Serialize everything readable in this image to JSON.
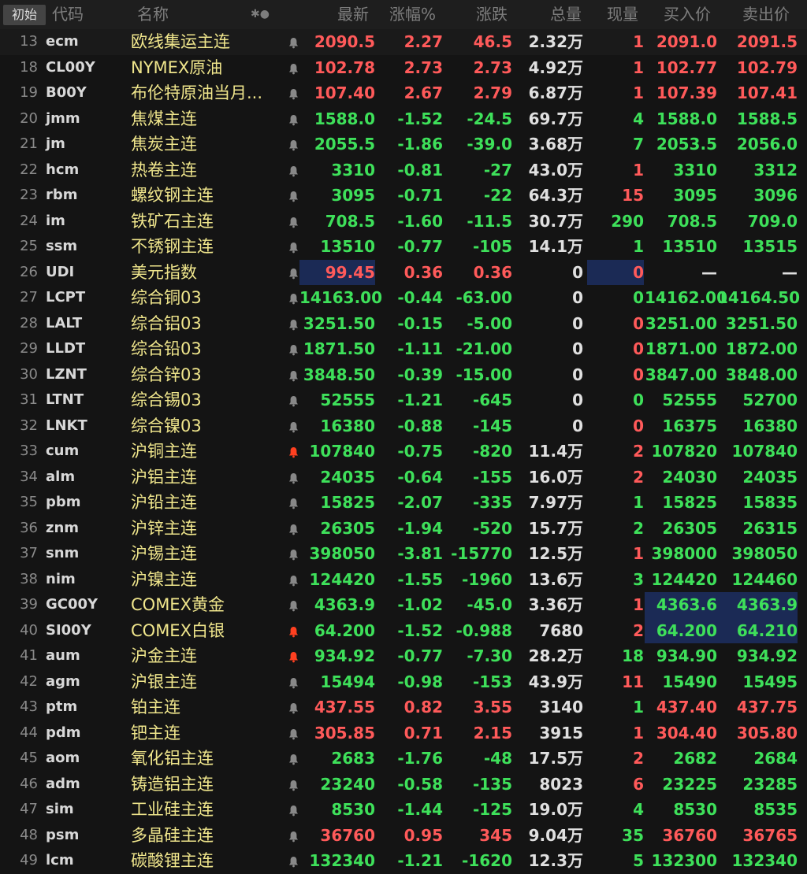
{
  "header": {
    "init_label": "初始",
    "col_code": "代码",
    "col_name": "名称",
    "col_icons": "✱●",
    "col_last": "最新",
    "col_pct": "涨幅%",
    "col_chg": "涨跌",
    "col_vol": "总量",
    "col_cur": "现量",
    "col_bid": "买入价",
    "col_ask": "卖出价"
  },
  "colors": {
    "up": "#ff5a5a",
    "down": "#3ee05a",
    "name": "#f0e68c",
    "bell_active": "#ff4020",
    "bell_idle": "#888888"
  },
  "rows": [
    {
      "num": "13",
      "code": "ecm",
      "name": "欧线集运主连",
      "bell": "idle",
      "last": "2090.5",
      "pct": "2.27",
      "chg": "46.5",
      "vol": "2.32万",
      "cur": "1",
      "bid": "2091.0",
      "ask": "2091.5",
      "dir": "up",
      "cur_dir": "up"
    },
    {
      "num": "18",
      "code": "CL00Y",
      "name": "NYMEX原油",
      "bell": "idle",
      "last": "102.78",
      "pct": "2.73",
      "chg": "2.73",
      "vol": "4.92万",
      "cur": "1",
      "bid": "102.77",
      "ask": "102.79",
      "dir": "up",
      "cur_dir": "up"
    },
    {
      "num": "19",
      "code": "B00Y",
      "name": "布伦特原油当月...",
      "bell": "idle",
      "last": "107.40",
      "pct": "2.67",
      "chg": "2.79",
      "vol": "6.87万",
      "cur": "1",
      "bid": "107.39",
      "ask": "107.41",
      "dir": "up",
      "cur_dir": "up"
    },
    {
      "num": "20",
      "code": "jmm",
      "name": "焦煤主连",
      "bell": "idle",
      "last": "1588.0",
      "pct": "-1.52",
      "chg": "-24.5",
      "vol": "69.7万",
      "cur": "4",
      "bid": "1588.0",
      "ask": "1588.5",
      "dir": "down",
      "cur_dir": "down"
    },
    {
      "num": "21",
      "code": "jm",
      "name": "焦炭主连",
      "bell": "idle",
      "last": "2055.5",
      "pct": "-1.86",
      "chg": "-39.0",
      "vol": "3.68万",
      "cur": "7",
      "bid": "2053.5",
      "ask": "2056.0",
      "dir": "down",
      "cur_dir": "down"
    },
    {
      "num": "22",
      "code": "hcm",
      "name": "热卷主连",
      "bell": "idle",
      "last": "3310",
      "pct": "-0.81",
      "chg": "-27",
      "vol": "43.0万",
      "cur": "1",
      "bid": "3310",
      "ask": "3312",
      "dir": "down",
      "cur_dir": "up"
    },
    {
      "num": "23",
      "code": "rbm",
      "name": "螺纹钢主连",
      "bell": "idle",
      "last": "3095",
      "pct": "-0.71",
      "chg": "-22",
      "vol": "64.3万",
      "cur": "15",
      "bid": "3095",
      "ask": "3096",
      "dir": "down",
      "cur_dir": "up"
    },
    {
      "num": "24",
      "code": "im",
      "name": "铁矿石主连",
      "bell": "idle",
      "last": "708.5",
      "pct": "-1.60",
      "chg": "-11.5",
      "vol": "30.7万",
      "cur": "290",
      "bid": "708.5",
      "ask": "709.0",
      "dir": "down",
      "cur_dir": "down"
    },
    {
      "num": "25",
      "code": "ssm",
      "name": "不锈钢主连",
      "bell": "idle",
      "last": "13510",
      "pct": "-0.77",
      "chg": "-105",
      "vol": "14.1万",
      "cur": "1",
      "bid": "13510",
      "ask": "13515",
      "dir": "down",
      "cur_dir": "down"
    },
    {
      "num": "26",
      "code": "UDI",
      "name": "美元指数",
      "bell": "idle",
      "last": "99.45",
      "pct": "0.36",
      "chg": "0.36",
      "vol": "0",
      "cur": "0",
      "bid": "—",
      "ask": "—",
      "dir": "up",
      "cur_dir": "up",
      "hl": true
    },
    {
      "num": "27",
      "code": "LCPT",
      "name": "综合铜03",
      "bell": "idle",
      "last": "14163.00",
      "pct": "-0.44",
      "chg": "-63.00",
      "vol": "0",
      "cur": "0",
      "bid": "14162.00",
      "ask": "14164.50",
      "dir": "down",
      "cur_dir": "down"
    },
    {
      "num": "28",
      "code": "LALT",
      "name": "综合铝03",
      "bell": "idle",
      "last": "3251.50",
      "pct": "-0.15",
      "chg": "-5.00",
      "vol": "0",
      "cur": "0",
      "bid": "3251.00",
      "ask": "3251.50",
      "dir": "down",
      "cur_dir": "up"
    },
    {
      "num": "29",
      "code": "LLDT",
      "name": "综合铅03",
      "bell": "idle",
      "last": "1871.50",
      "pct": "-1.11",
      "chg": "-21.00",
      "vol": "0",
      "cur": "0",
      "bid": "1871.00",
      "ask": "1872.00",
      "dir": "down",
      "cur_dir": "up"
    },
    {
      "num": "30",
      "code": "LZNT",
      "name": "综合锌03",
      "bell": "idle",
      "last": "3848.50",
      "pct": "-0.39",
      "chg": "-15.00",
      "vol": "0",
      "cur": "0",
      "bid": "3847.00",
      "ask": "3848.00",
      "dir": "down",
      "cur_dir": "up"
    },
    {
      "num": "31",
      "code": "LTNT",
      "name": "综合锡03",
      "bell": "idle",
      "last": "52555",
      "pct": "-1.21",
      "chg": "-645",
      "vol": "0",
      "cur": "0",
      "bid": "52555",
      "ask": "52700",
      "dir": "down",
      "cur_dir": "down"
    },
    {
      "num": "32",
      "code": "LNKT",
      "name": "综合镍03",
      "bell": "idle",
      "last": "16380",
      "pct": "-0.88",
      "chg": "-145",
      "vol": "0",
      "cur": "0",
      "bid": "16375",
      "ask": "16380",
      "dir": "down",
      "cur_dir": "up"
    },
    {
      "num": "33",
      "code": "cum",
      "name": "沪铜主连",
      "bell": "active",
      "last": "107840",
      "pct": "-0.75",
      "chg": "-820",
      "vol": "11.4万",
      "cur": "2",
      "bid": "107820",
      "ask": "107840",
      "dir": "down",
      "cur_dir": "up"
    },
    {
      "num": "34",
      "code": "alm",
      "name": "沪铝主连",
      "bell": "idle",
      "last": "24035",
      "pct": "-0.64",
      "chg": "-155",
      "vol": "16.0万",
      "cur": "2",
      "bid": "24030",
      "ask": "24035",
      "dir": "down",
      "cur_dir": "up"
    },
    {
      "num": "35",
      "code": "pbm",
      "name": "沪铅主连",
      "bell": "idle",
      "last": "15825",
      "pct": "-2.07",
      "chg": "-335",
      "vol": "7.97万",
      "cur": "1",
      "bid": "15825",
      "ask": "15835",
      "dir": "down",
      "cur_dir": "down"
    },
    {
      "num": "36",
      "code": "znm",
      "name": "沪锌主连",
      "bell": "idle",
      "last": "26305",
      "pct": "-1.94",
      "chg": "-520",
      "vol": "15.7万",
      "cur": "2",
      "bid": "26305",
      "ask": "26315",
      "dir": "down",
      "cur_dir": "down"
    },
    {
      "num": "37",
      "code": "snm",
      "name": "沪锡主连",
      "bell": "idle",
      "last": "398050",
      "pct": "-3.81",
      "chg": "-15770",
      "vol": "12.5万",
      "cur": "1",
      "bid": "398000",
      "ask": "398050",
      "dir": "down",
      "cur_dir": "up"
    },
    {
      "num": "38",
      "code": "nim",
      "name": "沪镍主连",
      "bell": "idle",
      "last": "124420",
      "pct": "-1.55",
      "chg": "-1960",
      "vol": "13.6万",
      "cur": "3",
      "bid": "124420",
      "ask": "124460",
      "dir": "down",
      "cur_dir": "down"
    },
    {
      "num": "39",
      "code": "GC00Y",
      "name": "COMEX黄金",
      "bell": "idle",
      "last": "4363.9",
      "pct": "-1.02",
      "chg": "-45.0",
      "vol": "3.36万",
      "cur": "1",
      "bid": "4363.6",
      "ask": "4363.9",
      "dir": "down",
      "cur_dir": "up",
      "hl_bidask": true
    },
    {
      "num": "40",
      "code": "SI00Y",
      "name": "COMEX白银",
      "bell": "active",
      "last": "64.200",
      "pct": "-1.52",
      "chg": "-0.988",
      "vol": "7680",
      "cur": "2",
      "bid": "64.200",
      "ask": "64.210",
      "dir": "down",
      "cur_dir": "up",
      "hl_bidask": true
    },
    {
      "num": "41",
      "code": "aum",
      "name": "沪金主连",
      "bell": "active",
      "last": "934.92",
      "pct": "-0.77",
      "chg": "-7.30",
      "vol": "28.2万",
      "cur": "18",
      "bid": "934.90",
      "ask": "934.92",
      "dir": "down",
      "cur_dir": "down"
    },
    {
      "num": "42",
      "code": "agm",
      "name": "沪银主连",
      "bell": "idle",
      "last": "15494",
      "pct": "-0.98",
      "chg": "-153",
      "vol": "43.9万",
      "cur": "11",
      "bid": "15490",
      "ask": "15495",
      "dir": "down",
      "cur_dir": "up"
    },
    {
      "num": "43",
      "code": "ptm",
      "name": "铂主连",
      "bell": "idle",
      "last": "437.55",
      "pct": "0.82",
      "chg": "3.55",
      "vol": "3140",
      "cur": "1",
      "bid": "437.40",
      "ask": "437.75",
      "dir": "up",
      "cur_dir": "down"
    },
    {
      "num": "44",
      "code": "pdm",
      "name": "钯主连",
      "bell": "idle",
      "last": "305.85",
      "pct": "0.71",
      "chg": "2.15",
      "vol": "3915",
      "cur": "1",
      "bid": "304.40",
      "ask": "305.80",
      "dir": "up",
      "cur_dir": "up"
    },
    {
      "num": "45",
      "code": "aom",
      "name": "氧化铝主连",
      "bell": "idle",
      "last": "2683",
      "pct": "-1.76",
      "chg": "-48",
      "vol": "17.5万",
      "cur": "2",
      "bid": "2682",
      "ask": "2684",
      "dir": "down",
      "cur_dir": "up"
    },
    {
      "num": "46",
      "code": "adm",
      "name": "铸造铝主连",
      "bell": "idle",
      "last": "23240",
      "pct": "-0.58",
      "chg": "-135",
      "vol": "8023",
      "cur": "6",
      "bid": "23225",
      "ask": "23285",
      "dir": "down",
      "cur_dir": "up"
    },
    {
      "num": "47",
      "code": "sim",
      "name": "工业硅主连",
      "bell": "idle",
      "last": "8530",
      "pct": "-1.44",
      "chg": "-125",
      "vol": "19.0万",
      "cur": "4",
      "bid": "8530",
      "ask": "8535",
      "dir": "down",
      "cur_dir": "down"
    },
    {
      "num": "48",
      "code": "psm",
      "name": "多晶硅主连",
      "bell": "idle",
      "last": "36760",
      "pct": "0.95",
      "chg": "345",
      "vol": "9.04万",
      "cur": "35",
      "bid": "36760",
      "ask": "36765",
      "dir": "up",
      "cur_dir": "down"
    },
    {
      "num": "49",
      "code": "lcm",
      "name": "碳酸锂主连",
      "bell": "idle",
      "last": "132340",
      "pct": "-1.21",
      "chg": "-1620",
      "vol": "12.3万",
      "cur": "5",
      "bid": "132300",
      "ask": "132340",
      "dir": "down",
      "cur_dir": "down"
    }
  ]
}
